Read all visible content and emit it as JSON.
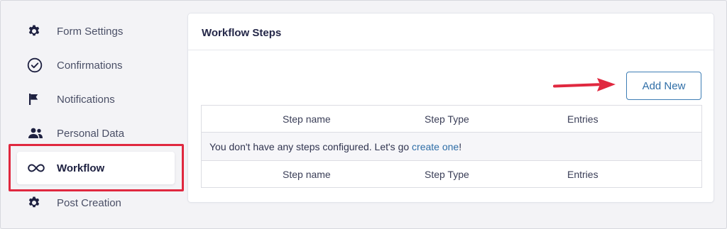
{
  "sidebar": {
    "items": [
      {
        "label": "Form Settings",
        "icon": "gear-icon"
      },
      {
        "label": "Confirmations",
        "icon": "check-circle-icon"
      },
      {
        "label": "Notifications",
        "icon": "flag-icon"
      },
      {
        "label": "Personal Data",
        "icon": "users-icon"
      },
      {
        "label": "Workflow",
        "icon": "workflow-icon",
        "active": true
      },
      {
        "label": "Post Creation",
        "icon": "gear-icon"
      }
    ]
  },
  "panel": {
    "title": "Workflow Steps",
    "add_new_label": "Add New",
    "table": {
      "columns": [
        "Step name",
        "Step Type",
        "Entries"
      ],
      "empty_message_prefix": "You don't have any steps configured. Let's go ",
      "empty_message_link": "create one",
      "empty_message_suffix": "!"
    }
  },
  "colors": {
    "accent": "#2f6ea7",
    "highlight": "#e0283f",
    "background": "#f3f3f6"
  }
}
